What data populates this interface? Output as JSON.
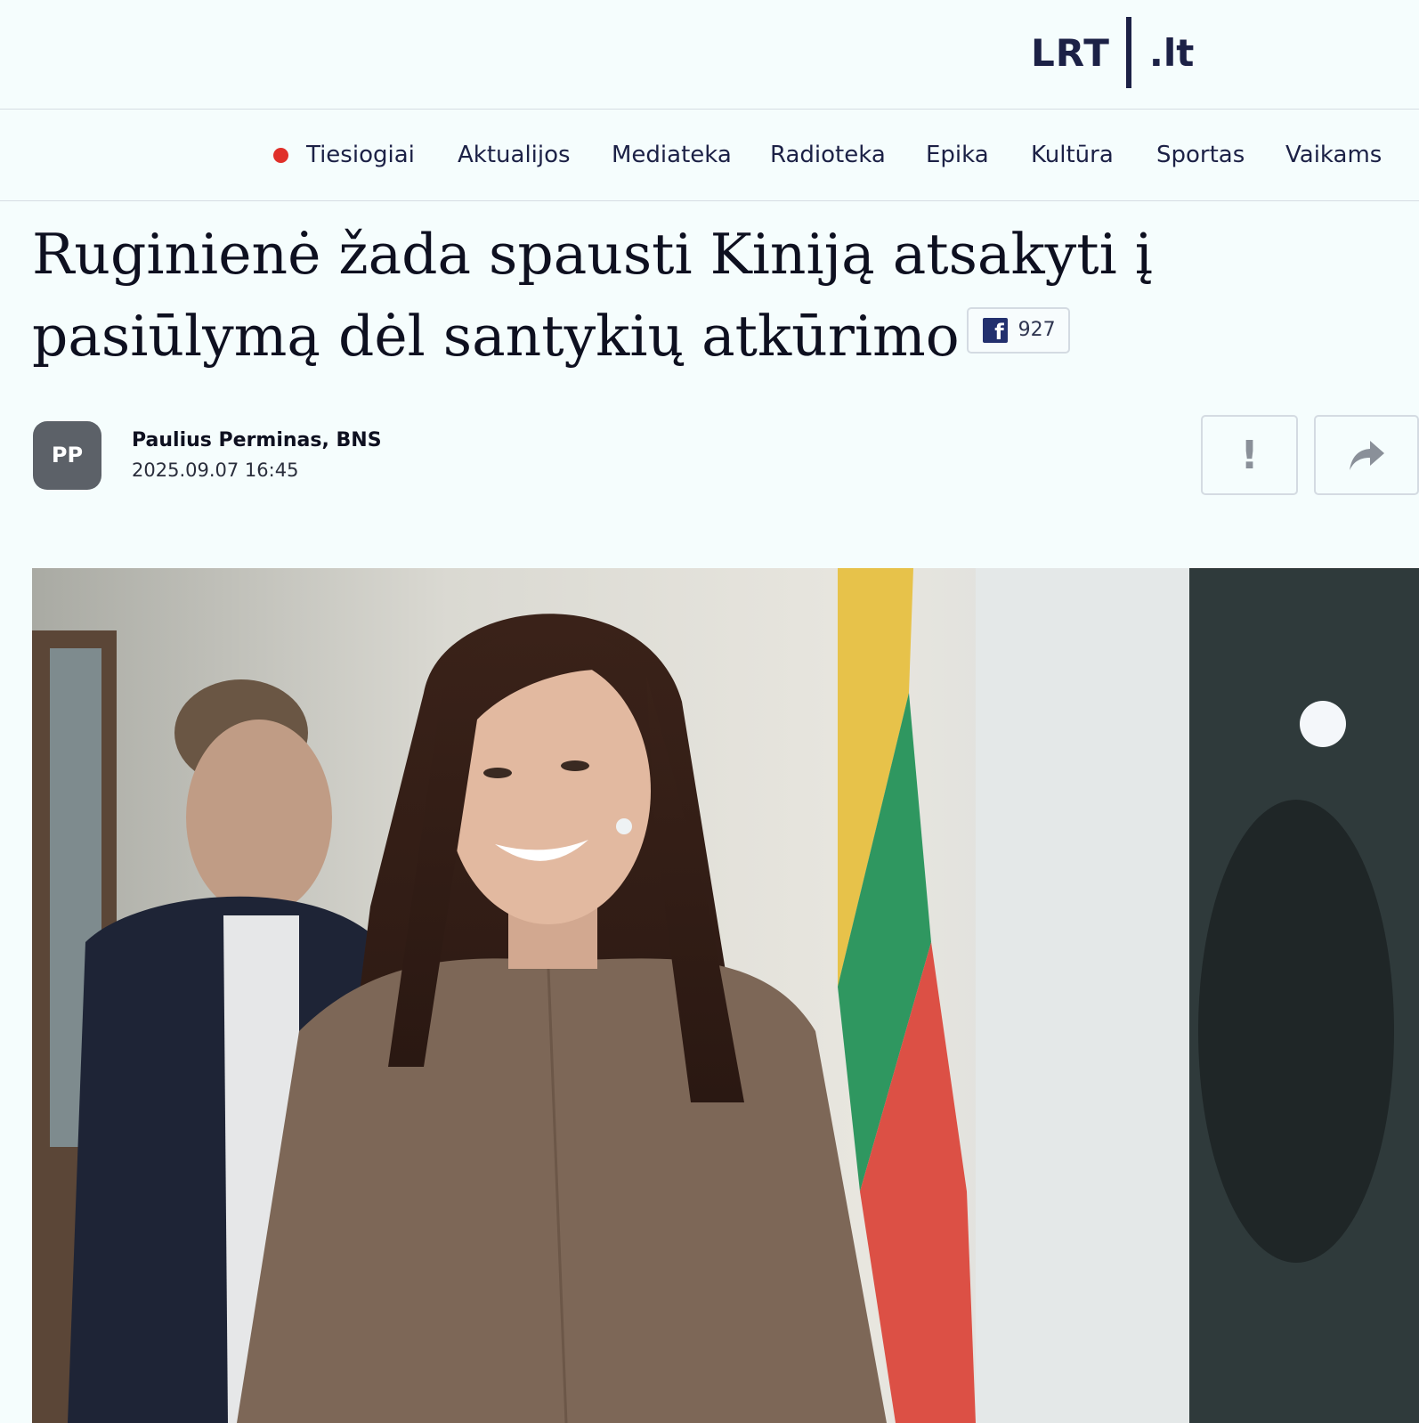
{
  "logo": {
    "lrt": "LRT",
    "domain": ".lt"
  },
  "nav": {
    "items": [
      {
        "label": "Tiesiogiai",
        "live": true
      },
      {
        "label": "Aktualijos"
      },
      {
        "label": "Mediateka"
      },
      {
        "label": "Radioteka"
      },
      {
        "label": "Epika"
      },
      {
        "label": "Kultūra"
      },
      {
        "label": "Sportas"
      },
      {
        "label": "Vaikams"
      }
    ]
  },
  "article": {
    "title": "Ruginienė žada spausti Kiniją atsakyti į pasiūlymą dėl santykių atkūrimo",
    "facebook_count": "927",
    "author_initials": "PP",
    "author": "Paulius Perminas, BNS",
    "date": "2025.09.07 16:45",
    "report_label": "!"
  },
  "colors": {
    "background": "#f5fdfd",
    "brand_navy": "#1c2146",
    "live_red": "#e0302a",
    "avatar_gray": "#5c6168"
  },
  "icons": {
    "facebook": "facebook-icon",
    "report": "report-icon",
    "share": "share-icon"
  }
}
